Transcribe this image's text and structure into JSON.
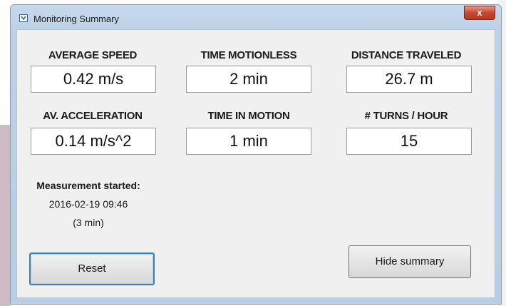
{
  "window": {
    "title": "Monitoring Summary",
    "close_glyph": "x"
  },
  "metrics": [
    {
      "label": "AVERAGE SPEED",
      "value": "0.42 m/s"
    },
    {
      "label": "TIME MOTIONLESS",
      "value": "2 min"
    },
    {
      "label": "DISTANCE TRAVELED",
      "value": "26.7 m"
    },
    {
      "label": "AV. ACCELERATION",
      "value": "0.14 m/s^2"
    },
    {
      "label": "TIME IN MOTION",
      "value": "1 min"
    },
    {
      "label": "# TURNS / HOUR",
      "value": "15"
    }
  ],
  "measurement": {
    "heading": "Measurement started:",
    "datetime": "2016-02-19 09:46",
    "duration": "(3 min)"
  },
  "buttons": {
    "reset": "Reset",
    "hide_summary": "Hide summary"
  },
  "colors": {
    "accent_focus": "#3c7fb1",
    "close_red": "#c5472f"
  }
}
